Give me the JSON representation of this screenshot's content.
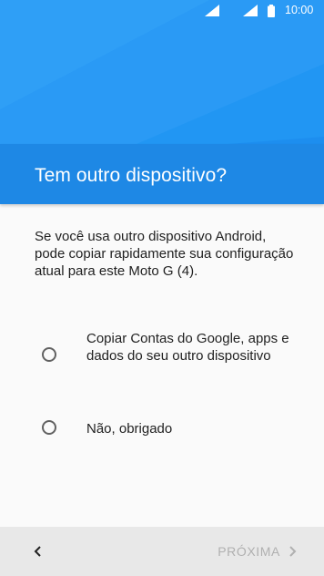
{
  "status_bar": {
    "time": "10:00",
    "icons": [
      "signal-icon",
      "signal-icon",
      "battery-icon"
    ]
  },
  "header": {
    "title": "Tem outro dispositivo?"
  },
  "main": {
    "description": "Se você usa outro dispositivo Android, pode copiar rapidamente sua configuração atual para este Moto G (4).",
    "options": [
      {
        "label": "Copiar Contas do Google, apps e dados do seu outro dispositivo",
        "selected": false
      },
      {
        "label": "Não, obrigado",
        "selected": false
      }
    ]
  },
  "footer": {
    "back_icon": "chevron-left-icon",
    "next_label": "PRÓXIMA",
    "next_icon": "chevron-right-icon"
  },
  "colors": {
    "hero": "#2196f3",
    "title_band": "#1e88e5",
    "background": "#fafafa",
    "bottom_bar": "#e8e8e8",
    "disabled_text": "#b0b0b0"
  }
}
